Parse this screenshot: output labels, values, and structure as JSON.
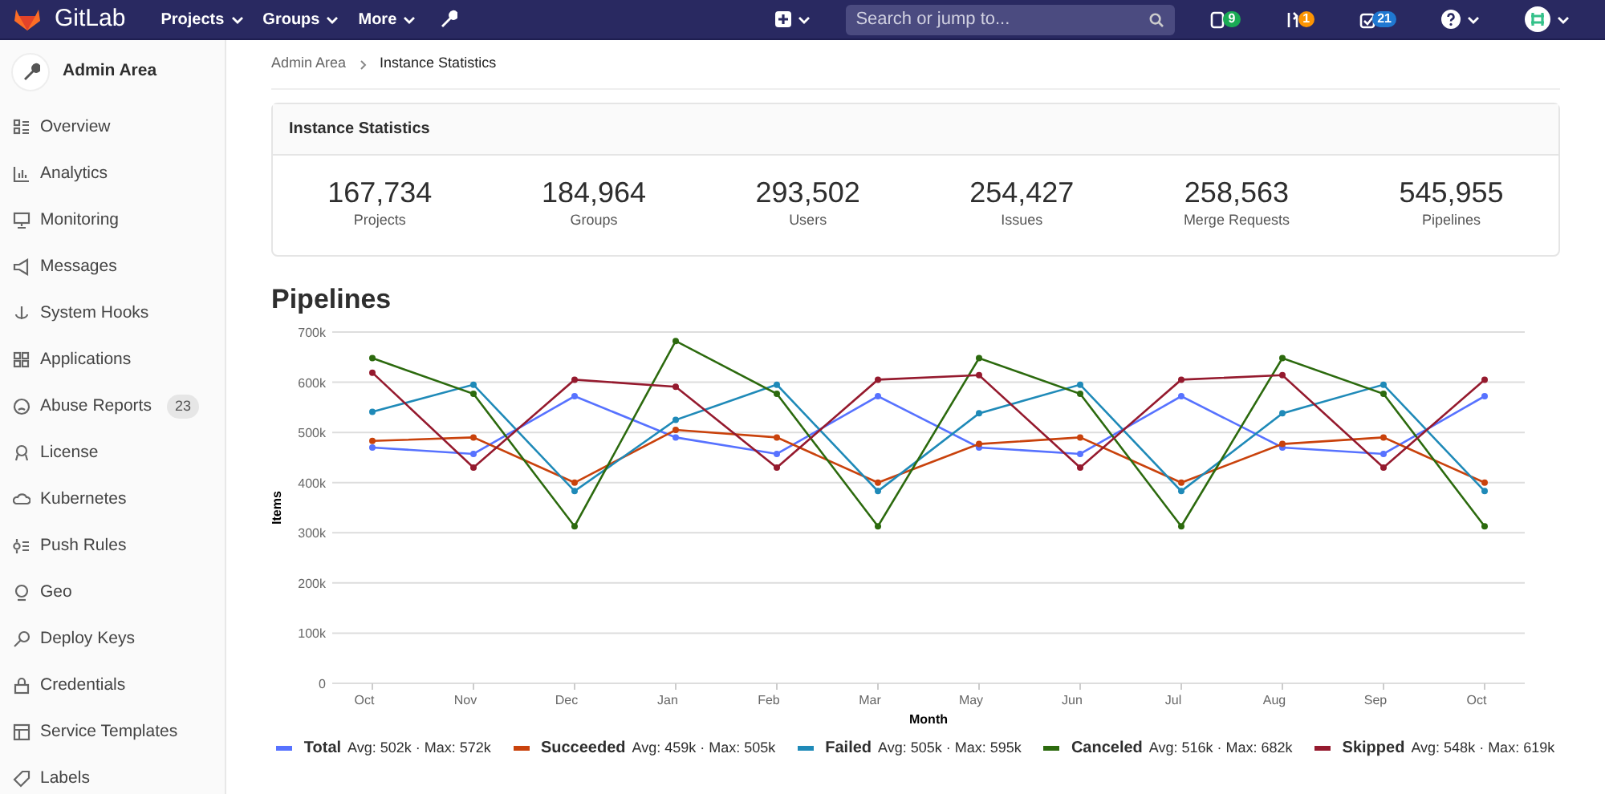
{
  "navbar": {
    "brand": "GitLab",
    "menus": [
      {
        "label": "Projects"
      },
      {
        "label": "Groups"
      },
      {
        "label": "More"
      }
    ],
    "search": {
      "placeholder": "Search or jump to..."
    },
    "counters": [
      {
        "count": "9",
        "color": "#1aaa55"
      },
      {
        "count": "1",
        "color": "#fc9403"
      },
      {
        "count": "21",
        "color": "#1f78d1"
      }
    ]
  },
  "sidebar": {
    "title": "Admin Area",
    "items": [
      {
        "label": "Overview"
      },
      {
        "label": "Analytics"
      },
      {
        "label": "Monitoring"
      },
      {
        "label": "Messages"
      },
      {
        "label": "System Hooks"
      },
      {
        "label": "Applications"
      },
      {
        "label": "Abuse Reports",
        "badge": "23"
      },
      {
        "label": "License"
      },
      {
        "label": "Kubernetes"
      },
      {
        "label": "Push Rules"
      },
      {
        "label": "Geo"
      },
      {
        "label": "Deploy Keys"
      },
      {
        "label": "Credentials"
      },
      {
        "label": "Service Templates"
      },
      {
        "label": "Labels"
      }
    ]
  },
  "breadcrumb": [
    "Admin Area",
    "Instance Statistics"
  ],
  "statistics": {
    "title": "Instance Statistics",
    "items": [
      {
        "value": "167,734",
        "label": "Projects"
      },
      {
        "value": "184,964",
        "label": "Groups"
      },
      {
        "value": "293,502",
        "label": "Users"
      },
      {
        "value": "254,427",
        "label": "Issues"
      },
      {
        "value": "258,563",
        "label": "Merge Requests"
      },
      {
        "value": "545,955",
        "label": "Pipelines"
      }
    ]
  },
  "pipelines": {
    "title": "Pipelines",
    "legend_stats": [
      "Avg: 502k · Max: 572k",
      "Avg: 459k · Max: 505k",
      "Avg: 505k · Max: 595k",
      "Avg: 516k · Max: 682k",
      "Avg: 548k · Max: 619k"
    ],
    "chart_data": {
      "type": "line",
      "xlabel": "Month",
      "ylabel": "Items",
      "categories": [
        "Oct",
        "Nov",
        "Dec",
        "Jan",
        "Feb",
        "Mar",
        "May",
        "Jun",
        "Jul",
        "Aug",
        "Sep",
        "Oct"
      ],
      "ylim": [
        0,
        700000
      ],
      "grid": true,
      "yticks": [
        {
          "value": 0,
          "label": "0"
        },
        {
          "value": 100000,
          "label": "100k"
        },
        {
          "value": 200000,
          "label": "200k"
        },
        {
          "value": 300000,
          "label": "300k"
        },
        {
          "value": 400000,
          "label": "400k"
        },
        {
          "value": 500000,
          "label": "500k"
        },
        {
          "value": 600000,
          "label": "600k"
        },
        {
          "value": 700000,
          "label": "700k"
        }
      ],
      "series": [
        {
          "name": "Total",
          "color": "#5772ff",
          "marker": "circle",
          "values": [
            470000,
            457000,
            572000,
            490000,
            457000,
            572000,
            470000,
            457000,
            572000,
            470000,
            457000,
            572000
          ]
        },
        {
          "name": "Succeeded",
          "color": "#c9420c",
          "marker": "circle",
          "values": [
            483000,
            490000,
            400000,
            505000,
            490000,
            400000,
            477000,
            490000,
            400000,
            477000,
            490000,
            400000
          ]
        },
        {
          "name": "Failed",
          "color": "#1f8ab8",
          "marker": "circle",
          "values": [
            541000,
            595000,
            383000,
            525000,
            595000,
            383000,
            538000,
            595000,
            383000,
            538000,
            595000,
            383000
          ]
        },
        {
          "name": "Canceled",
          "color": "#2c6a0e",
          "marker": "circle",
          "values": [
            648000,
            577000,
            313000,
            682000,
            577000,
            313000,
            648000,
            577000,
            313000,
            648000,
            577000,
            313000
          ]
        },
        {
          "name": "Skipped",
          "color": "#951a2e",
          "marker": "circle",
          "values": [
            619000,
            430000,
            605000,
            591000,
            430000,
            605000,
            614000,
            430000,
            605000,
            614000,
            430000,
            605000
          ]
        }
      ]
    }
  }
}
